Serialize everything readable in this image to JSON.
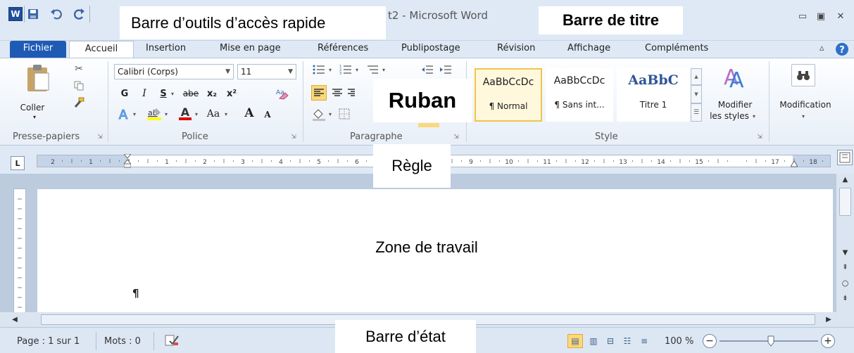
{
  "window": {
    "title": "t2 - Microsoft Word",
    "logo_letter": "W"
  },
  "annotations": {
    "qat": "Barre d’outils d’accès rapide",
    "title_bar": "Barre de titre",
    "ribbon": "Ruban",
    "ruler": "Règle",
    "work_area": "Zone de travail",
    "status_bar": "Barre d’état"
  },
  "tabs": [
    {
      "label": "Fichier"
    },
    {
      "label": "Accueil"
    },
    {
      "label": "Insertion"
    },
    {
      "label": "Mise en page"
    },
    {
      "label": "Références"
    },
    {
      "label": "Publipostage"
    },
    {
      "label": "Révision"
    },
    {
      "label": "Affichage"
    },
    {
      "label": "Compléments"
    }
  ],
  "ribbon": {
    "clipboard": {
      "paste_label": "Coller",
      "group_label": "Presse-papiers"
    },
    "font": {
      "font_name": "Calibri (Corps)",
      "font_size": "11",
      "bold": "G",
      "italic": "I",
      "underline": "S",
      "strike": "abe",
      "subscript": "x₂",
      "superscript": "x²",
      "change_case": "Aa",
      "grow": "A",
      "shrink": "A",
      "group_label": "Police"
    },
    "paragraph": {
      "group_label": "Paragraphe"
    },
    "styles": {
      "items": [
        {
          "preview": "AaBbCcDc",
          "name": "¶ Normal"
        },
        {
          "preview": "AaBbCcDc",
          "name": "¶ Sans int..."
        },
        {
          "preview": "AaBbC",
          "name": "Titre 1"
        }
      ],
      "modify_label_1": "Modifier",
      "modify_label_2": "les styles",
      "group_label": "Style"
    },
    "editing": {
      "label": "Modification"
    }
  },
  "ruler": {
    "marks": [
      "2",
      "1",
      "1",
      "1",
      "2",
      "3",
      "4",
      "5",
      "6",
      "9",
      "10",
      "11",
      "12",
      "13",
      "14",
      "15",
      "17",
      "18"
    ]
  },
  "document": {
    "pilcrow": "¶"
  },
  "status": {
    "page": "Page : 1 sur 1",
    "words": "Mots : 0",
    "zoom": "100 %"
  },
  "colors": {
    "accent": "#1f5bb5",
    "chrome": "#dfe9f5",
    "workspace": "#bccbde"
  }
}
